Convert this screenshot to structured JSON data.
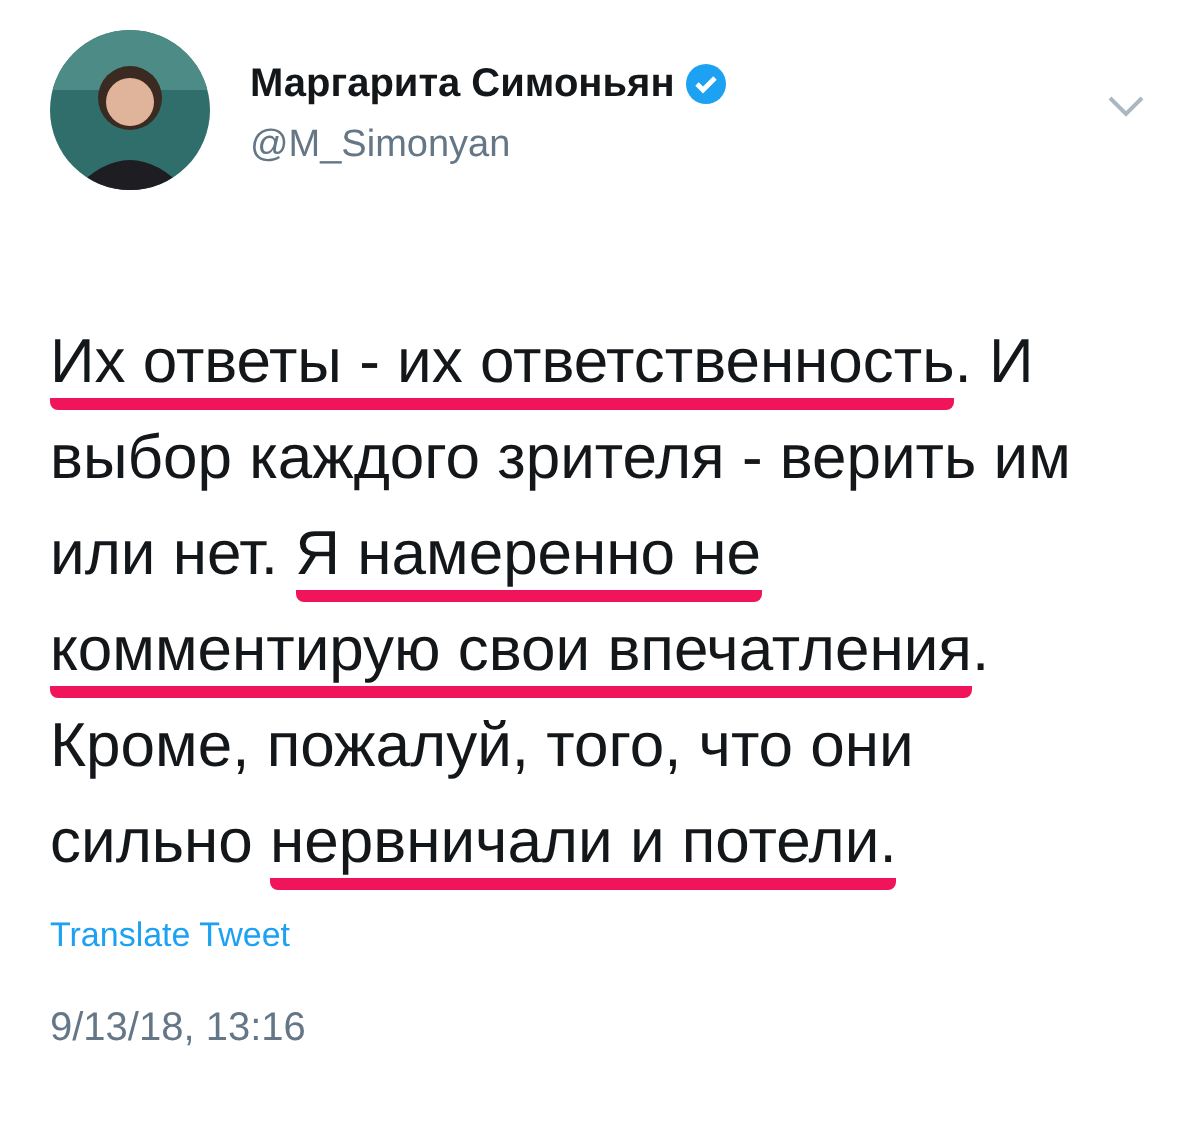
{
  "author": {
    "name": "Маргарита Симоньян",
    "handle": "@M_Simonyan",
    "verified": true
  },
  "lines": [
    {
      "segments": [
        {
          "text": "Их ответы - их ответственность",
          "underlined": true
        },
        {
          "text": ". И",
          "underlined": false
        }
      ]
    },
    {
      "segments": [
        {
          "text": "выбор каждого зрителя - верить им",
          "underlined": false
        }
      ]
    },
    {
      "segments": [
        {
          "text": "или нет. ",
          "underlined": false
        },
        {
          "text": "Я намеренно не",
          "underlined": true
        }
      ]
    },
    {
      "segments": [
        {
          "text": "комментирую свои впечатления",
          "underlined": true
        },
        {
          "text": ".",
          "underlined": false
        }
      ]
    },
    {
      "segments": [
        {
          "text": "Кроме, пожалуй, того, что они",
          "underlined": false
        }
      ]
    },
    {
      "segments": [
        {
          "text": "сильно ",
          "underlined": false
        },
        {
          "text": "нервничали и потели.",
          "underlined": true
        }
      ]
    }
  ],
  "translate_link": "Translate Tweet",
  "timestamp": "9/13/18, 13:16"
}
